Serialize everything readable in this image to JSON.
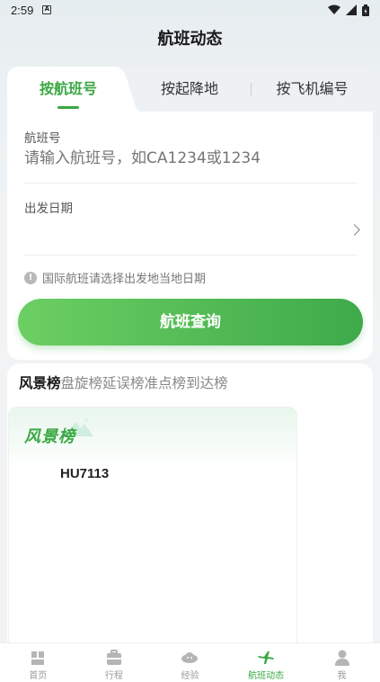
{
  "status_bar": {
    "time": "2:59",
    "notif_icon": "a-box-icon"
  },
  "header": {
    "title": "航班动态"
  },
  "tabs": [
    {
      "label": "按航班号",
      "active": true
    },
    {
      "label": "按起降地",
      "active": false
    },
    {
      "label": "按飞机编号",
      "active": false
    }
  ],
  "form": {
    "flight_no_label": "航班号",
    "flight_no_placeholder": "请输入航班号，如CA1234或1234",
    "date_label": "出发日期",
    "hint": "国际航班请选择出发地当地日期",
    "query_button": "航班查询"
  },
  "rankings": {
    "tabs": [
      "风景榜",
      "盘旋榜",
      "延误榜",
      "准点榜",
      "到达榜"
    ],
    "active_index": 0,
    "panel_title": "风景榜",
    "flights": [
      "HU7113"
    ]
  },
  "bottom_nav": [
    {
      "label": "首页",
      "icon": "home-icon"
    },
    {
      "label": "行程",
      "icon": "suitcase-icon"
    },
    {
      "label": "经验",
      "icon": "planet-icon"
    },
    {
      "label": "航班动态",
      "icon": "airplane-icon",
      "active": true
    },
    {
      "label": "我",
      "icon": "person-icon"
    }
  ],
  "colors": {
    "accent": "#3aa843",
    "button_start": "#6ccf63",
    "button_end": "#3eaa4a"
  }
}
